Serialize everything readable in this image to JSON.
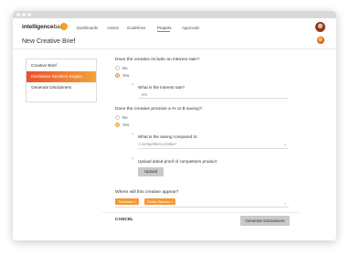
{
  "nav": {
    "logo_bold": "intelligence",
    "logo_light": "bank",
    "items": [
      {
        "label": "Dashboards"
      },
      {
        "label": "Assets"
      },
      {
        "label": "Guidelines"
      },
      {
        "label": "Projects"
      },
      {
        "label": "Approvals"
      }
    ],
    "active": "Projects"
  },
  "page": {
    "title": "New Creative Brief"
  },
  "sidebar": {
    "items": [
      {
        "label": "Creative Brief"
      },
      {
        "label": "Disclaimer Decision Engine"
      },
      {
        "label": "Generate Disclaimers"
      }
    ],
    "active_index": 1
  },
  "form": {
    "q1": {
      "question": "Does the creative include an interest rate?:",
      "options": [
        "No",
        "Yes"
      ],
      "selected": "Yes",
      "sub_label": "What is the interest rate?",
      "sub_value": "5%"
    },
    "q2": {
      "question": "Does the creative promise a % or $ saving?:",
      "options": [
        "No",
        "Yes"
      ],
      "selected": "Yes",
      "sub1_label": "What is the saving compared to:",
      "sub1_value": "A competitors product",
      "sub2_label": "Upload dated proof of competitors product:",
      "upload_label": "Upload"
    },
    "q3": {
      "question": "Where will this creative appear?",
      "tags": [
        "Television ×",
        "Online Banner ×"
      ]
    }
  },
  "footer": {
    "cancel_label": "CANCEL",
    "generate_label": "Generate Disclaimers"
  },
  "colors": {
    "accent": "#f29935",
    "accent_gradient_start": "#e9502f",
    "accent_gradient_end": "#f5a23a",
    "button_gray": "#c9c9c9"
  }
}
